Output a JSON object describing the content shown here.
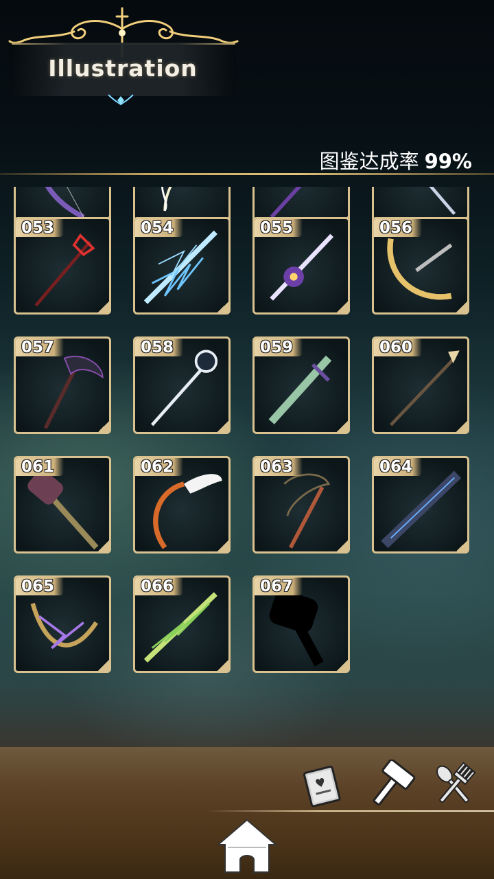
{
  "header": {
    "title": "Illustration"
  },
  "completion": {
    "label": "图鉴达成率",
    "value": "99%"
  },
  "colors": {
    "frame": "#d9c28f",
    "accent_gold": "#e3c27a"
  },
  "weapons": [
    {
      "num": "",
      "icon": "bat-wing-bow-icon"
    },
    {
      "num": "",
      "icon": "light-bow-icon"
    },
    {
      "num": "",
      "icon": "dark-spear-icon"
    },
    {
      "num": "",
      "icon": "silver-lance-icon"
    },
    {
      "num": "053",
      "icon": "crimson-trident-icon"
    },
    {
      "num": "054",
      "icon": "lightning-spear-icon"
    },
    {
      "num": "055",
      "icon": "amethyst-sword-icon"
    },
    {
      "num": "056",
      "icon": "golden-crossbow-icon"
    },
    {
      "num": "057",
      "icon": "thorn-scythe-icon"
    },
    {
      "num": "058",
      "icon": "moon-staff-icon"
    },
    {
      "num": "059",
      "icon": "jade-sword-icon"
    },
    {
      "num": "060",
      "icon": "bronze-spear-icon"
    },
    {
      "num": "061",
      "icon": "vine-hammer-icon"
    },
    {
      "num": "062",
      "icon": "angel-wing-bow-icon"
    },
    {
      "num": "063",
      "icon": "rope-staff-icon"
    },
    {
      "num": "064",
      "icon": "rune-greatsword-icon"
    },
    {
      "num": "065",
      "icon": "arcane-bow-icon"
    },
    {
      "num": "066",
      "icon": "verdant-spear-icon"
    },
    {
      "num": "067",
      "icon": "locked-hammer-silhouette-icon"
    }
  ],
  "nav": {
    "book_icon": "recipe-book-icon",
    "hammer_icon": "forge-hammer-icon",
    "cutlery_icon": "cooking-utensils-icon",
    "home_icon": "home-icon"
  }
}
